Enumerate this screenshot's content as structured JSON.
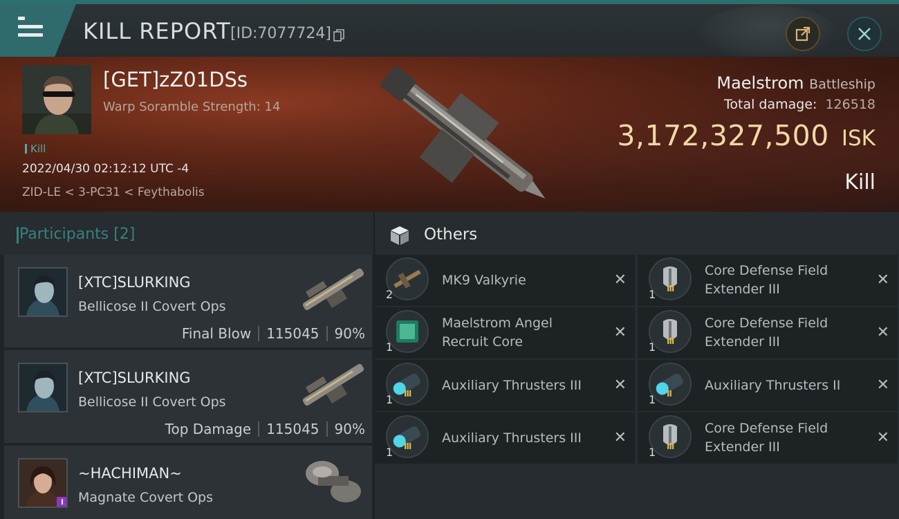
{
  "header": {
    "title": "KILL REPORT",
    "report_id": "[ID:7077724]"
  },
  "victim": {
    "name": "[GET]zZ01DSs",
    "scramble": "Warp Soramble Strength: 14",
    "tag": "Kill",
    "timestamp": "2022/04/30 02:12:12 UTC -4",
    "location": "ZID-LE < 3-PC31 < Feythabolis",
    "ship_name": "Maelstrom",
    "ship_class": "Battleship",
    "damage_label": "Total damage:",
    "damage_value": "126518",
    "isk_amount": "3,172,327,500",
    "isk_unit": "ISK",
    "result": "Kill"
  },
  "participants": {
    "title": "Participants [2]",
    "rows": [
      {
        "name": "[XTC]SLURKING",
        "ship": "Bellicose II Covert Ops",
        "role": "Final Blow",
        "damage": "115045",
        "percent": "90%"
      },
      {
        "name": "[XTC]SLURKING",
        "ship": "Bellicose II Covert Ops",
        "role": "Top Damage",
        "damage": "115045",
        "percent": "90%"
      },
      {
        "name": "~HACHIMAN~",
        "ship": "Magnate Covert Ops",
        "badge": "i"
      }
    ]
  },
  "others": {
    "title": "Others",
    "items": [
      {
        "qty": "2",
        "label": "MK9  Valkyrie",
        "icon": "drone-icon"
      },
      {
        "qty": "1",
        "label": "Core Defense Field Extender III",
        "icon": "rig-icon",
        "tier": "III"
      },
      {
        "qty": "1",
        "label": "Maelstrom Angel Recruit Core",
        "icon": "core-icon"
      },
      {
        "qty": "1",
        "label": "Core Defense Field Extender III",
        "icon": "rig-icon",
        "tier": "III"
      },
      {
        "qty": "1",
        "label": "Auxiliary Thrusters III",
        "icon": "thruster-icon",
        "tier": "III"
      },
      {
        "qty": "1",
        "label": "Auxiliary Thrusters II",
        "icon": "thruster-icon",
        "tier": "II"
      },
      {
        "qty": "1",
        "label": "Auxiliary Thrusters III",
        "icon": "thruster-icon",
        "tier": "III"
      },
      {
        "qty": "1",
        "label": "Core Defense Field Extender III",
        "icon": "rig-icon",
        "tier": "III"
      }
    ],
    "remove_glyph": "✕"
  },
  "colors": {
    "accent": "#3b7f80",
    "isk_gold": "#f1d9a5",
    "banner_red": "#5e2616"
  }
}
